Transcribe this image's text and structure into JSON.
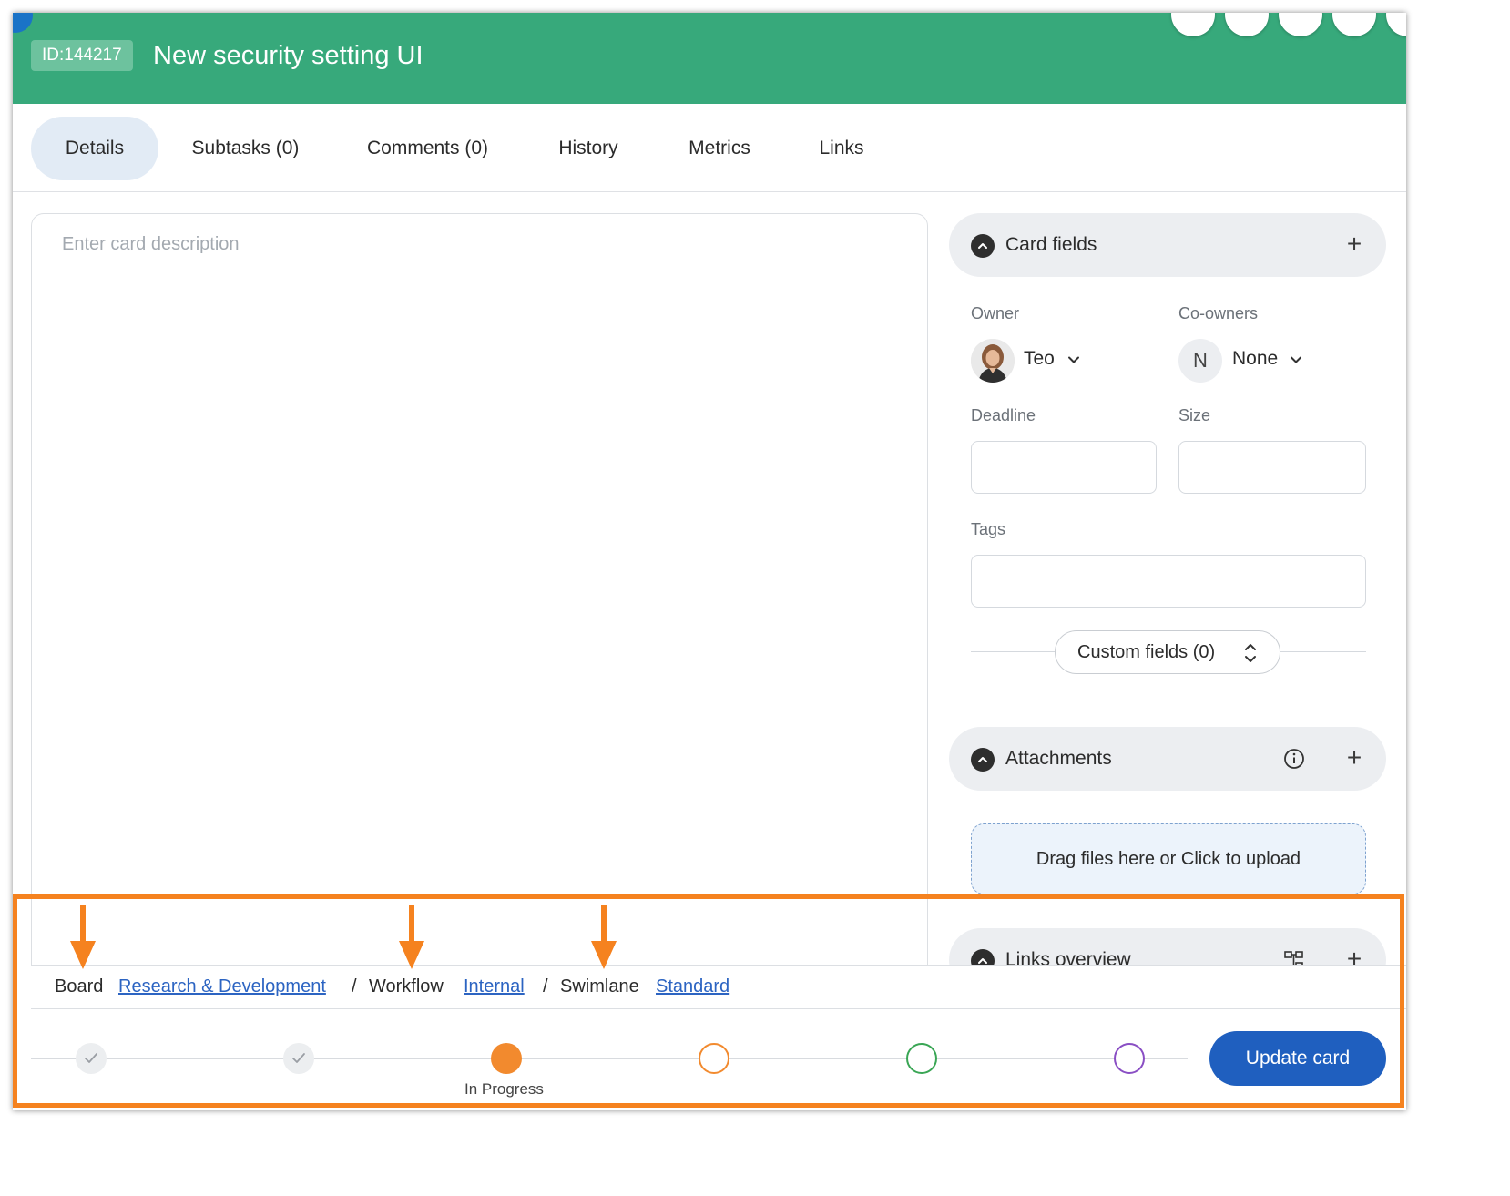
{
  "header": {
    "card_id": "ID:144217",
    "card_title": "New security setting UI",
    "color": "#37a97b"
  },
  "tabs": [
    {
      "label": "Details",
      "active": true
    },
    {
      "label": "Subtasks (0)"
    },
    {
      "label": "Comments (0)"
    },
    {
      "label": "History"
    },
    {
      "label": "Metrics"
    },
    {
      "label": "Links"
    }
  ],
  "description": {
    "placeholder": "Enter card description"
  },
  "card_fields": {
    "title": "Card fields",
    "owner": {
      "label": "Owner",
      "value": "Teo"
    },
    "co_owners": {
      "label": "Co-owners",
      "avatar_initial": "N",
      "value": "None"
    },
    "deadline": {
      "label": "Deadline",
      "value": ""
    },
    "size": {
      "label": "Size",
      "value": ""
    },
    "tags": {
      "label": "Tags",
      "value": ""
    },
    "custom_fields_label": "Custom fields (0)"
  },
  "attachments": {
    "title": "Attachments",
    "dropzone_label": "Drag files here or Click to upload"
  },
  "links_overview": {
    "title": "Links overview"
  },
  "breadcrumb": {
    "board_label": "Board",
    "board_value": "Research & Development",
    "sep": "/",
    "workflow_label": "Workflow",
    "workflow_value": "Internal",
    "swimlane_label": "Swimlane",
    "swimlane_value": "Standard"
  },
  "workflow_steps": [
    {
      "state": "done",
      "color": "#eceef0"
    },
    {
      "state": "done",
      "color": "#eceef0"
    },
    {
      "state": "current",
      "label": "In Progress",
      "color": "#f28a2e"
    },
    {
      "state": "future",
      "color": "#f28a2e"
    },
    {
      "state": "future",
      "color": "#3aa655"
    },
    {
      "state": "future",
      "color": "#8a4fc4"
    }
  ],
  "update_button_label": "Update card",
  "annotation": {
    "highlight_color": "#f5821f"
  }
}
